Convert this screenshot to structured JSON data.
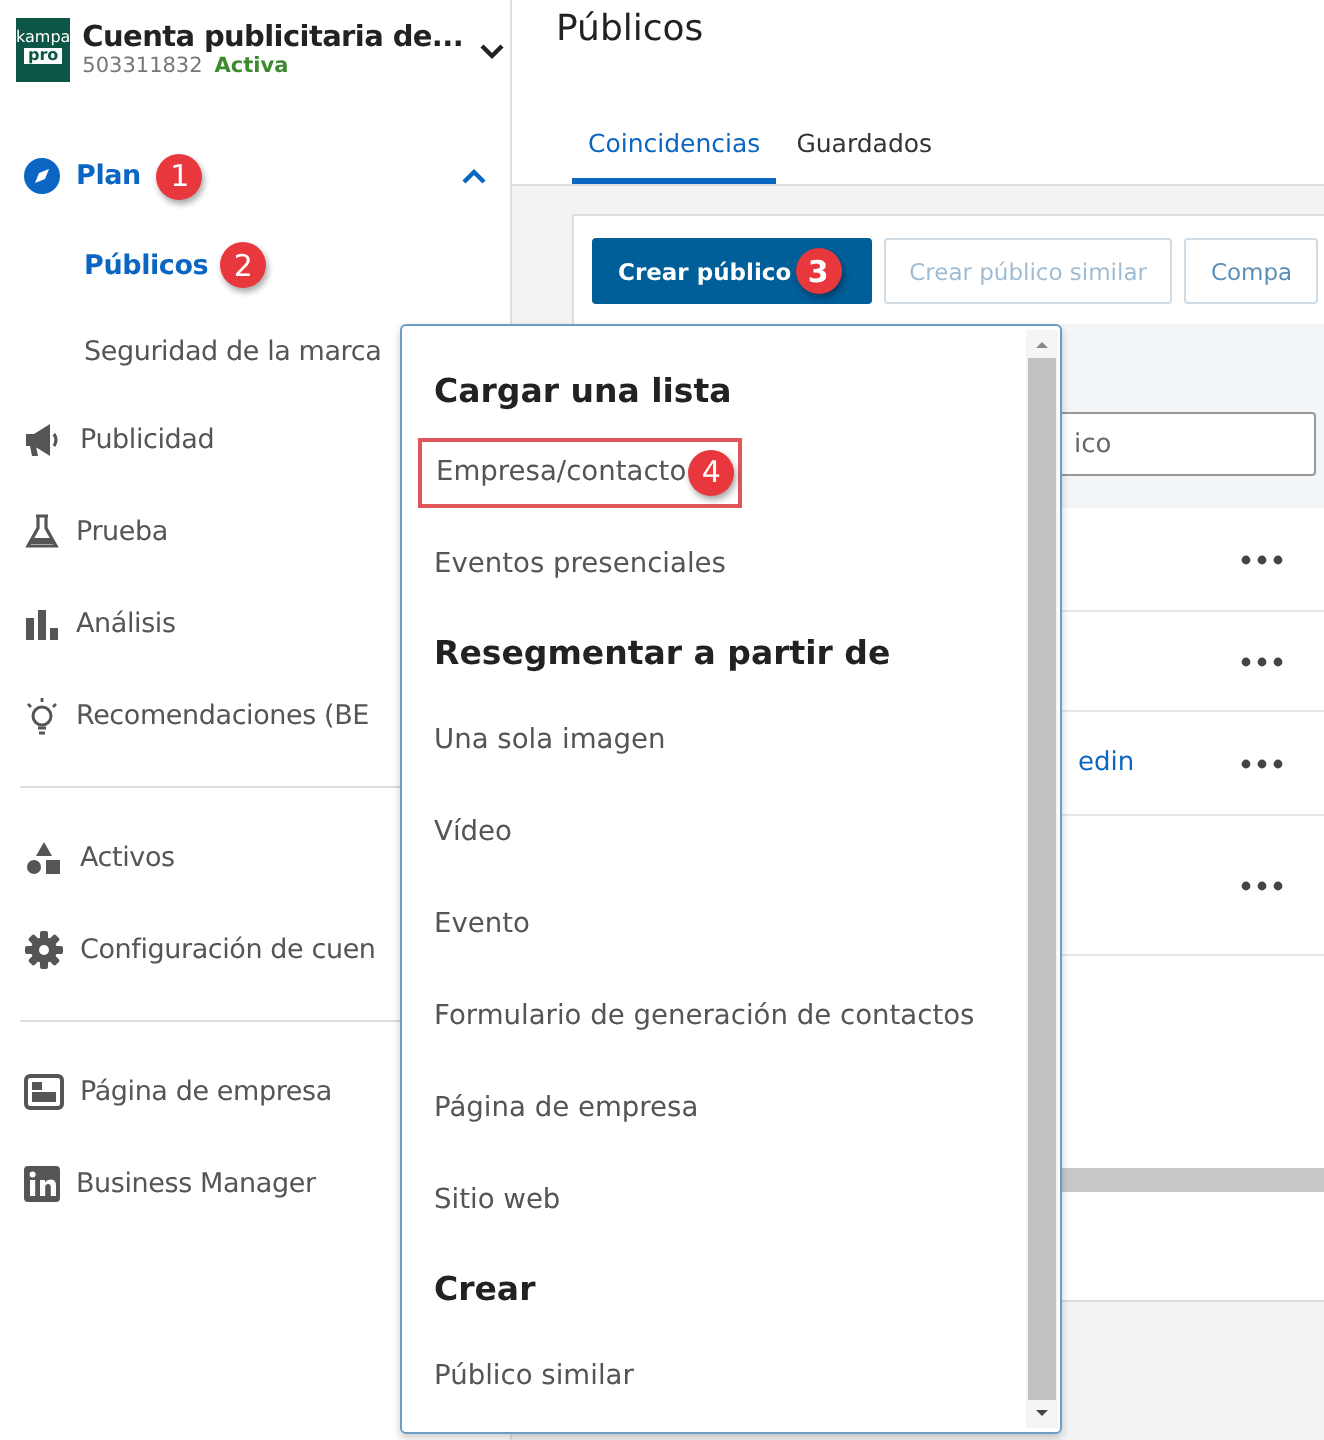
{
  "account": {
    "logo": {
      "line_1": "kampa",
      "line_2": "pro"
    },
    "name": "Cuenta publicitaria de...",
    "id": "503311832",
    "status": "Activa",
    "expanded": false
  },
  "sidebar": {
    "groups": [
      {
        "items": [
          {
            "label": "Plan",
            "selected": true,
            "expanded": true,
            "annotation": "1",
            "children": [
              {
                "label": "Públicos",
                "selected": true,
                "annotation": "2"
              },
              {
                "label": "Seguridad de la marca",
                "selected": false
              }
            ]
          },
          {
            "label": "Publicidad",
            "selected": false
          },
          {
            "label": "Prueba",
            "selected": false
          },
          {
            "label": "Análisis",
            "selected": false
          },
          {
            "label": "Recomendaciones (BE",
            "selected": false
          }
        ]
      },
      {
        "items": [
          {
            "label": "Activos",
            "selected": false
          },
          {
            "label": "Configuración de cuen",
            "selected": false
          }
        ]
      },
      {
        "items": [
          {
            "label": "Página de empresa",
            "selected": false
          },
          {
            "label": "Business Manager",
            "selected": false
          }
        ]
      }
    ]
  },
  "page": {
    "title": "Públicos",
    "tabs": [
      {
        "label": "Coincidencias",
        "selected": true
      },
      {
        "label": "Guardados",
        "selected": false
      }
    ],
    "buttons": [
      {
        "label": "Crear público",
        "kind": "primary",
        "annotation": "3"
      },
      {
        "label": "Crear público similar",
        "kind": "secondary",
        "disabled": true
      },
      {
        "label": "Compa",
        "kind": "secondary",
        "disabled": false
      }
    ],
    "search": {
      "placeholder": "ico"
    },
    "rows": [
      {
        "link": ""
      },
      {
        "link": ""
      },
      {
        "link": "edin"
      },
      {
        "link": ""
      }
    ]
  },
  "dropdown": {
    "items": [
      {
        "kind": "heading",
        "label": "Cargar una lista"
      },
      {
        "kind": "item",
        "label": "Empresa/contacto",
        "highlighted": true,
        "annotation": "4"
      },
      {
        "kind": "item",
        "label": "Eventos presenciales",
        "highlighted": false
      },
      {
        "kind": "heading",
        "label": "Resegmentar a partir de"
      },
      {
        "kind": "item",
        "label": "Una sola imagen",
        "highlighted": false
      },
      {
        "kind": "item",
        "label": "Vídeo",
        "highlighted": false
      },
      {
        "kind": "item",
        "label": "Evento",
        "highlighted": false
      },
      {
        "kind": "item",
        "label": "Formulario de generación de contactos",
        "highlighted": false
      },
      {
        "kind": "item",
        "label": "Página de empresa",
        "highlighted": false
      },
      {
        "kind": "item",
        "label": "Sitio web",
        "highlighted": false
      },
      {
        "kind": "heading",
        "label": "Crear"
      },
      {
        "kind": "item",
        "label": "Público similar",
        "highlighted": false
      }
    ]
  }
}
